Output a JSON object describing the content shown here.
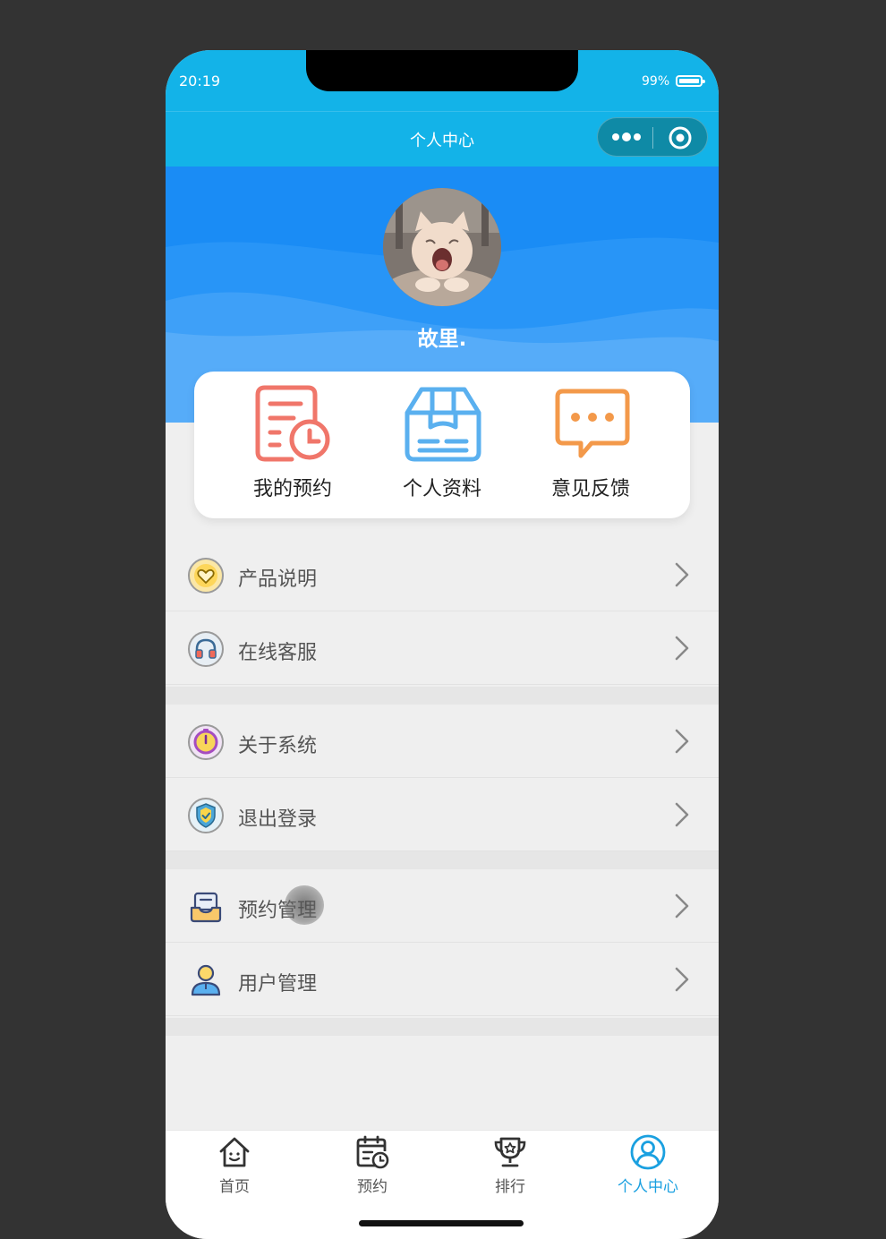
{
  "status_bar": {
    "time": "20:19",
    "battery": "99%"
  },
  "nav": {
    "title": "个人中心",
    "more_icon": "more-dots-icon",
    "close_icon": "target-circle-icon"
  },
  "profile": {
    "username": "故里."
  },
  "quick_actions": [
    {
      "label": "我的预约",
      "icon": "appointment-doc-clock-icon",
      "color": "#f0766a"
    },
    {
      "label": "个人资料",
      "icon": "box-profile-icon",
      "color": "#5ab0ef"
    },
    {
      "label": "意见反馈",
      "icon": "chat-bubble-icon",
      "color": "#f3994a"
    }
  ],
  "menu": {
    "group1": [
      {
        "label": "产品说明",
        "icon": "heart-badge-icon"
      },
      {
        "label": "在线客服",
        "icon": "headphones-icon"
      }
    ],
    "group2": [
      {
        "label": "关于系统",
        "icon": "timer-badge-icon"
      },
      {
        "label": "退出登录",
        "icon": "shield-check-icon"
      }
    ],
    "group3": [
      {
        "label": "预约管理",
        "icon": "inbox-tray-icon"
      },
      {
        "label": "用户管理",
        "icon": "user-icon"
      }
    ]
  },
  "tabbar": {
    "tabs": [
      {
        "label": "首页",
        "icon": "home-icon"
      },
      {
        "label": "预约",
        "icon": "calendar-clock-icon"
      },
      {
        "label": "排行",
        "icon": "trophy-icon"
      },
      {
        "label": "个人中心",
        "icon": "user-circle-icon",
        "active": true
      }
    ],
    "active_color": "#1aa0e0"
  },
  "colors": {
    "primary": "#13b3e8",
    "header_blue": "#1a8cf5",
    "background": "#efefef"
  }
}
